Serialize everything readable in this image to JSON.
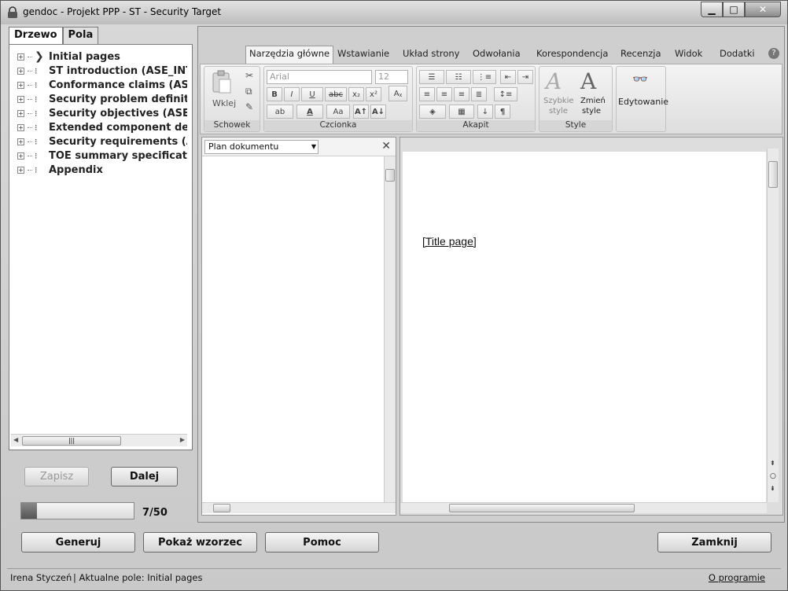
{
  "window": {
    "title": "gendoc - Projekt PPP - ST - Security Target"
  },
  "left_panel": {
    "tabs": [
      {
        "label": "Drzewo",
        "active": true
      },
      {
        "label": "Pola",
        "active": false
      }
    ],
    "tree": [
      {
        "label": "Initial pages",
        "selected": true
      },
      {
        "label": "ST introduction (ASE_INT"
      },
      {
        "label": "Conformance claims (ASE"
      },
      {
        "label": "Security problem definitio"
      },
      {
        "label": "Security objectives (ASE_"
      },
      {
        "label": "Extended component defi"
      },
      {
        "label": "Security requirements (AS"
      },
      {
        "label": "TOE summary specificatio"
      },
      {
        "label": "Appendix"
      }
    ],
    "buttons": {
      "save": "Zapisz",
      "next": "Dalej"
    },
    "progress": {
      "text": "7/50",
      "value": 0.14
    }
  },
  "word": {
    "tabs": [
      "Narzędzia główne",
      "Wstawianie",
      "Układ strony",
      "Odwołania",
      "Korespondencja",
      "Recenzja",
      "Widok",
      "Dodatki"
    ],
    "active_tab": "Narzędzia główne",
    "groups": {
      "clipboard": {
        "name": "Schowek",
        "paste": "Wklej"
      },
      "font": {
        "name": "Czcionka",
        "font_name": "Arial",
        "font_size": "12"
      },
      "paragraph": {
        "name": "Akapit"
      },
      "styles": {
        "name": "Style",
        "quick": "Szybkie",
        "quick2": "style",
        "change": "Zmień",
        "change2": "style"
      },
      "editing": {
        "name": "Edytowanie"
      }
    },
    "nav": {
      "select": "Plan dokumentu"
    },
    "document": {
      "text": "[Title page]"
    }
  },
  "bottom_buttons": {
    "generate": "Generuj",
    "show_template": "Pokaż wzorzec",
    "help": "Pomoc",
    "close": "Zamknij"
  },
  "status": {
    "user": "Irena Styczeń",
    "current": "| Aktualne pole: Initial pages",
    "about": "O programie"
  }
}
